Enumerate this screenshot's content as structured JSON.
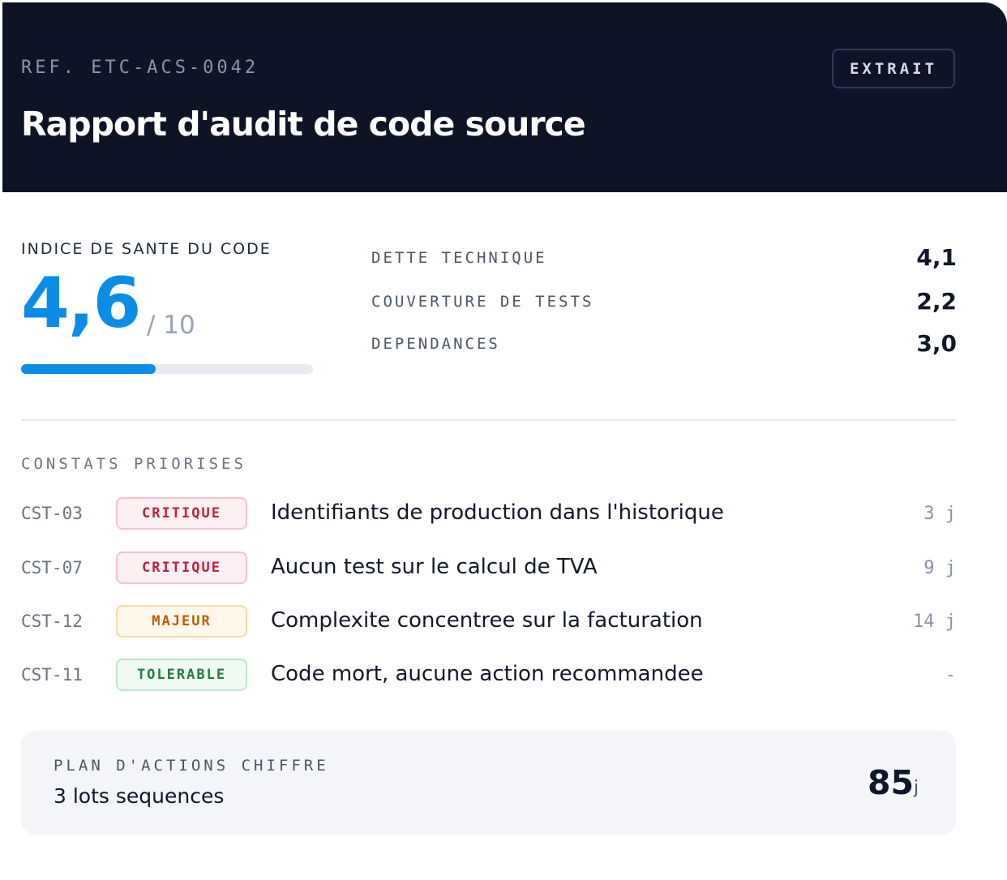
{
  "header": {
    "ref": "REF. ETC-ACS-0042",
    "title": "Rapport d'audit de code source",
    "badge": "EXTRAIT"
  },
  "score": {
    "label": "INDICE DE SANTE DU CODE",
    "value": "4,6",
    "max": "/ 10",
    "progress_fraction": 0.46
  },
  "metrics": [
    {
      "label": "DETTE TECHNIQUE",
      "value": "4,1"
    },
    {
      "label": "COUVERTURE DE TESTS",
      "value": "2,2"
    },
    {
      "label": "DEPENDANCES",
      "value": "3,0"
    }
  ],
  "findings": {
    "title": "CONSTATS PRIORISES",
    "rows": [
      {
        "id": "CST-03",
        "severity": "CRITIQUE",
        "text": "Identifiants de production dans l'historique",
        "effort": "3 j"
      },
      {
        "id": "CST-07",
        "severity": "CRITIQUE",
        "text": "Aucun test sur le calcul de TVA",
        "effort": "9 j"
      },
      {
        "id": "CST-12",
        "severity": "MAJEUR",
        "text": "Complexite concentree sur la facturation",
        "effort": "14 j"
      },
      {
        "id": "CST-11",
        "severity": "TOLERABLE",
        "text": "Code mort, aucune action recommandee",
        "effort": "-"
      }
    ]
  },
  "plan": {
    "label": "PLAN D'ACTIONS CHIFFRE",
    "subtitle": "3 lots sequences",
    "value": "85",
    "unit": "j"
  },
  "colors": {
    "header_bg": "#0e1426",
    "accent": "#0b8ce6",
    "critique": "#c21f3a",
    "majeur": "#b45f06",
    "tolerable": "#237a46"
  }
}
